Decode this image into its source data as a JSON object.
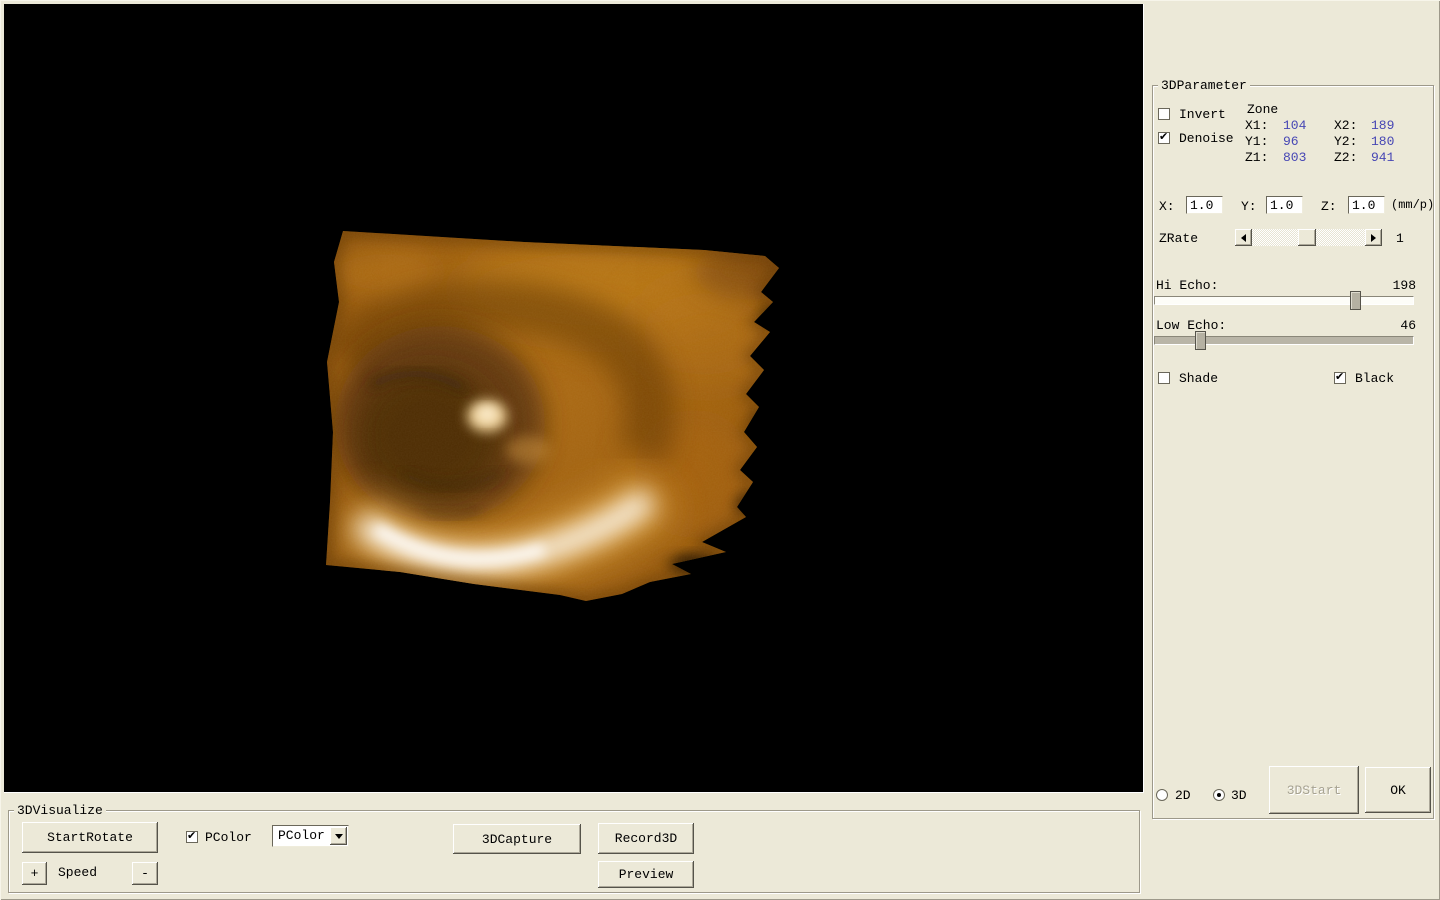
{
  "parameter_panel": {
    "title": "3DParameter",
    "invert_label": "Invert",
    "invert_checked": false,
    "denoise_label": "Denoise",
    "denoise_checked": true,
    "zone": {
      "title": "Zone",
      "value_color": "#4646b4",
      "rows": [
        {
          "l1": "X1:",
          "v1": "104",
          "l2": "X2:",
          "v2": "189"
        },
        {
          "l1": "Y1:",
          "v1": "96",
          "l2": "Y2:",
          "v2": "180"
        },
        {
          "l1": "Z1:",
          "v1": "803",
          "l2": "Z2:",
          "v2": "941"
        }
      ]
    },
    "scale": {
      "x_label": "X:",
      "x_value": "1.0",
      "y_label": "Y:",
      "y_value": "1.0",
      "z_label": "Z:",
      "z_value": "1.0",
      "unit": "(mm/p)"
    },
    "zrate": {
      "label": "ZRate",
      "value": "1"
    },
    "hi_echo": {
      "label": "Hi Echo:",
      "value": 198,
      "max": 255
    },
    "low_echo": {
      "label": "Low Echo:",
      "value": 46,
      "max": 255
    },
    "shade_label": "Shade",
    "shade_checked": false,
    "black_label": "Black",
    "black_checked": true,
    "mode_2d_label": "2D",
    "mode_2d_selected": false,
    "mode_3d_label": "3D",
    "mode_3d_selected": true,
    "start_button_label": "3DStart",
    "start_button_enabled": false,
    "ok_button_label": "OK"
  },
  "visualize_panel": {
    "title": "3DVisualize",
    "start_rotate_label": "StartRotate",
    "speed_plus_label": "+",
    "speed_label": "Speed",
    "speed_minus_label": "-",
    "pcolor_label": "PColor",
    "pcolor_checked": true,
    "pcolor_dropdown_value": "PColor",
    "capture_label": "3DCapture",
    "record_label": "Record3D",
    "preview_label": "Preview"
  },
  "colors": {
    "window_bg": "#ece9d8",
    "viewport_bg": "#000000",
    "zone_value": "#4646b4"
  }
}
